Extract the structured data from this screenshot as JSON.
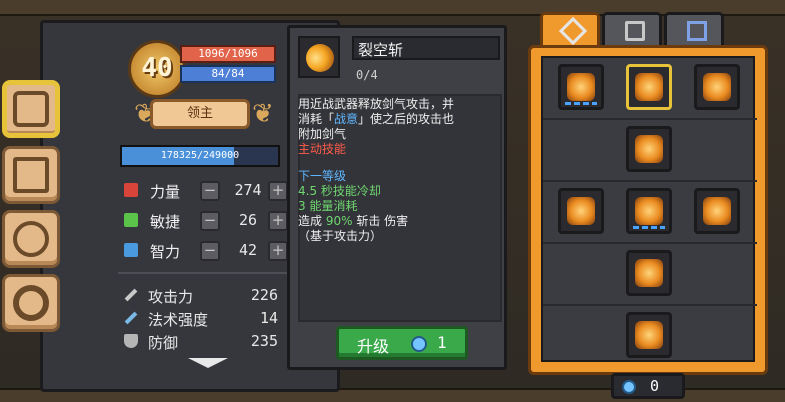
{
  "character": {
    "level": "40",
    "hp": "1096/1096",
    "mp": "84/84",
    "title": "领主",
    "exp": "178325/249000",
    "exp_fraction": 0.716
  },
  "attributes": [
    {
      "label": "力量",
      "value": "274",
      "icon": "fist-icon",
      "color": "#d9443a"
    },
    {
      "label": "敏捷",
      "value": "26",
      "icon": "feather-icon",
      "color": "#5bc24a"
    },
    {
      "label": "智力",
      "value": "42",
      "icon": "book-icon",
      "color": "#4a9ae0"
    }
  ],
  "derived": [
    {
      "label": "攻击力",
      "value": "226",
      "icon": "sword-icon"
    },
    {
      "label": "法术强度",
      "value": "14",
      "icon": "wand-icon"
    },
    {
      "label": "防御",
      "value": "235",
      "icon": "shield-icon"
    }
  ],
  "tooltip": {
    "name": "裂空斩",
    "level": "0/4",
    "line1": "用近战武器释放剑气攻击，并",
    "line2a": "消耗「",
    "line2b": "战意",
    "line2c": "」使之后的攻击也",
    "line3": "附加剑气",
    "active": "主动技能",
    "next_header": "下一等级",
    "next_1": "4.5 秒技能冷却",
    "next_2": "3 能量消耗",
    "next_3a": "造成 ",
    "next_3b": "90%",
    "next_3c": " 斩击 伤害",
    "next_4": "（基于攻击力）",
    "upgrade_label": "升级",
    "upgrade_cost": "1"
  },
  "currency": {
    "amount": "0"
  }
}
